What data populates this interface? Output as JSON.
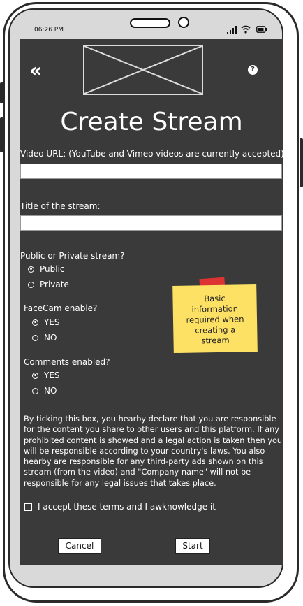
{
  "status": {
    "time": "06:26 PM"
  },
  "header": {
    "back_icon": "double-chevron-left-icon",
    "help_glyph": "?"
  },
  "page": {
    "title": "Create Stream"
  },
  "form": {
    "video_url_label": "Video URL: (YouTube and Vimeo videos are currently accepted)",
    "video_url_value": "",
    "stream_title_label": "Title of the stream:",
    "stream_title_value": "",
    "visibility_label": "Public or Private stream?",
    "visibility_options": [
      "Public",
      "Private"
    ],
    "visibility_selected": "Public",
    "facecam_label": "FaceCam enable?",
    "facecam_options": [
      "YES",
      "NO"
    ],
    "facecam_selected": "YES",
    "comments_label": "Comments enabled?",
    "comments_options": [
      "YES",
      "NO"
    ],
    "comments_selected": "YES"
  },
  "note": {
    "line1": "Basic",
    "line2": "information",
    "line3": "required when",
    "line4": "creating a",
    "line5": "stream"
  },
  "terms": {
    "text": "By ticking this box, you hearby declare that you are responsible for the content you share to other users and this platform. If any prohibited content is showed and a legal action is taken then you will be responsible according to your country's laws. You also hearby are responsible for any third-party ads shown on this stream (from the video) and \"Company name\" will not be responsible for any legal issues that takes place.",
    "accept_label": "I accept these terms and I awknowledge it",
    "accepted": false
  },
  "buttons": {
    "cancel": "Cancel",
    "start": "Start"
  },
  "colors": {
    "screen_bg": "#3a3a3a",
    "note_bg": "#fde164",
    "tape": "#dd3333"
  }
}
